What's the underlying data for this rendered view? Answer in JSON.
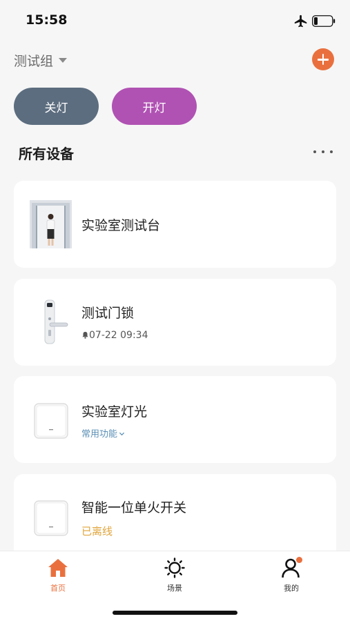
{
  "status_bar": {
    "time": "15:58",
    "airplane_icon": "airplane-icon",
    "battery_icon": "battery-low-icon"
  },
  "header": {
    "group_name": "测试组",
    "add_icon": "plus-circle-icon",
    "accent_color": "#e9703e"
  },
  "quick_actions": {
    "off_label": "关灯",
    "on_label": "开灯",
    "off_color": "#5c6d7f",
    "on_color": "#b052b3"
  },
  "section": {
    "title": "所有设备",
    "more_icon": "more-horizontal-icon"
  },
  "devices": [
    {
      "name": "实验室测试台",
      "subtitle": "",
      "image": "person-scene-image"
    },
    {
      "name": "测试门锁",
      "subtitle": "07-22 09:34",
      "subtitle_icon": "bell-icon",
      "image": "door-lock-image"
    },
    {
      "name": "实验室灯光",
      "subtitle": "常用功能",
      "subtitle_icon": "chevron-down-icon",
      "subtitle_color": "#5a8fb5",
      "image": "wall-switch-image"
    },
    {
      "name": "智能一位单火开关",
      "subtitle": "已离线",
      "subtitle_color": "#e0a43a",
      "image": "wall-switch-image"
    }
  ],
  "tab_bar": {
    "tabs": [
      {
        "label": "首页",
        "icon": "home-icon",
        "active": true
      },
      {
        "label": "场景",
        "icon": "sun-icon",
        "active": false
      },
      {
        "label": "我的",
        "icon": "user-icon",
        "active": false
      }
    ]
  }
}
